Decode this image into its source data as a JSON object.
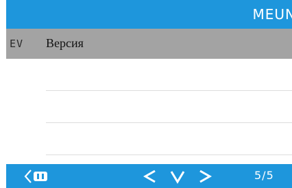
{
  "header": {
    "title": "MEUN"
  },
  "menu": {
    "items": [
      {
        "code": "EV",
        "label": "Версия",
        "selected": true
      },
      {
        "code": "",
        "label": "",
        "selected": false
      },
      {
        "code": "",
        "label": "",
        "selected": false
      },
      {
        "code": "",
        "label": "",
        "selected": false
      }
    ]
  },
  "footer": {
    "page": "5/5",
    "icons": {
      "back": "back-icon",
      "left": "chevron-left-icon",
      "down": "chevron-down-icon",
      "right": "chevron-right-icon"
    }
  },
  "colors": {
    "accent": "#1e96dc",
    "selected_row": "#a3a3a3",
    "text": "#111111",
    "on_accent": "#ffffff"
  }
}
